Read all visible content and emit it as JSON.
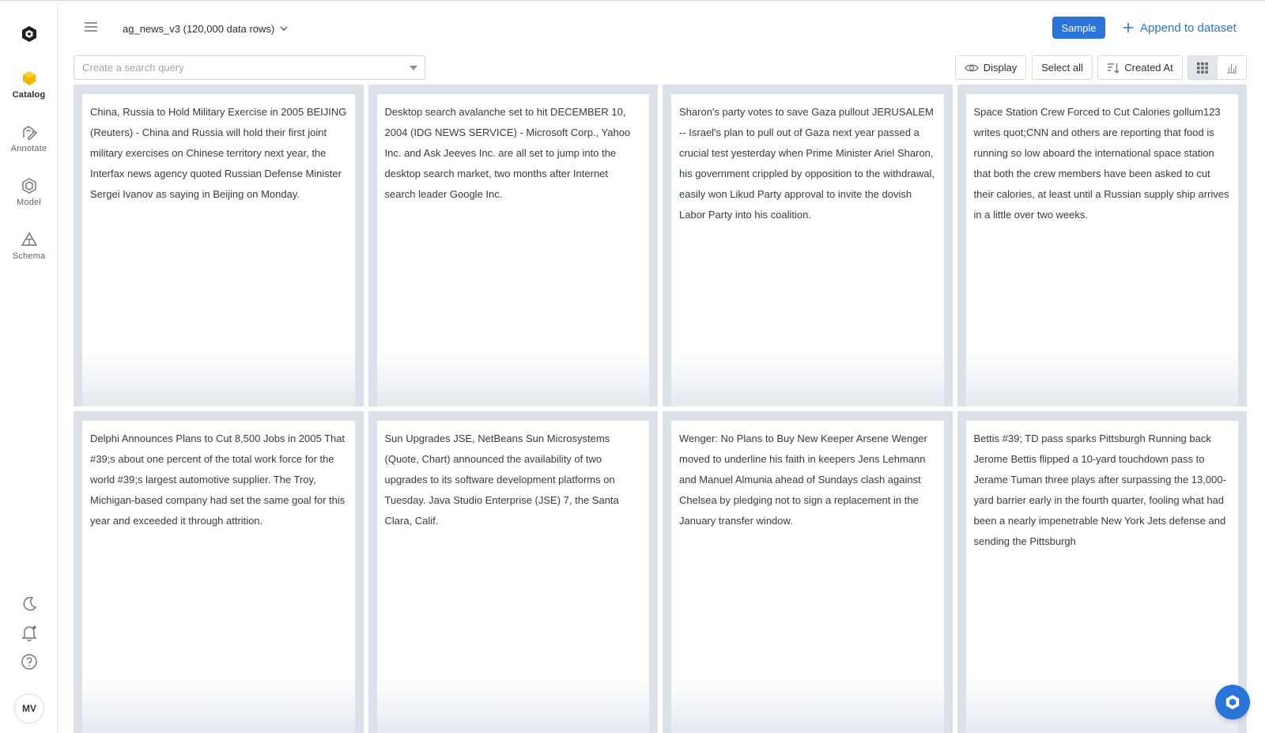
{
  "app": {
    "accent_color": "#2a74d8",
    "logo_icon": "labelbox-logo-icon"
  },
  "sidebar": {
    "items": [
      {
        "label": "Catalog",
        "icon": "catalog-icon",
        "active": true
      },
      {
        "label": "Annotate",
        "icon": "annotate-icon",
        "active": false
      },
      {
        "label": "Model",
        "icon": "model-icon",
        "active": false
      },
      {
        "label": "Schema",
        "icon": "schema-icon",
        "active": false
      }
    ],
    "bottom_icons": [
      "dark-mode-moon-icon",
      "notifications-bell-icon",
      "help-icon"
    ],
    "avatar_initials": "MV"
  },
  "header": {
    "dataset_label": "ag_news_v3 (120,000 data rows)",
    "sample_label": "Sample",
    "append_label": "Append to dataset"
  },
  "toolbar": {
    "search_placeholder": "Create a search query",
    "display_label": "Display",
    "select_all_label": "Select all",
    "sort_label": "Created At",
    "active_view": "grid"
  },
  "cards": [
    {
      "text": "China, Russia to Hold Military Exercise in 2005 BEIJING (Reuters) - China and Russia will hold their first  joint military exercises on Chinese territory next year, the  Interfax news agency quoted Russian Defense Minister Sergei  Ivanov as saying in Beijing on Monday."
    },
    {
      "text": "Desktop search avalanche set to hit DECEMBER 10, 2004 (IDG NEWS SERVICE) - Microsoft Corp., Yahoo Inc. and Ask Jeeves Inc. are all set to jump into the desktop search market, two months after Internet search leader Google Inc."
    },
    {
      "text": "Sharon's party votes to save Gaza pullout  JERUSALEM -- Israel's plan to pull out of Gaza next year passed a crucial test yesterday when Prime Minister Ariel Sharon, his government crippled by opposition to the withdrawal, easily won Likud Party approval to invite the dovish Labor Party into his coalition."
    },
    {
      "text": "Space Station Crew Forced to Cut Calories gollum123 writes  quot;CNN and others are reporting that food is running so low aboard the international space station that both the crew members have been asked to cut their calories, at least until a Russian supply ship arrives in a little over two weeks."
    },
    {
      "text": "Delphi Announces Plans to Cut 8,500 Jobs in 2005 That #39;s about one percent of the total work force for the world #39;s largest automotive supplier. The Troy, Michigan-based company had set the same goal for this year and exceeded it through attrition."
    },
    {
      "text": "Sun Upgrades JSE, NetBeans Sun Microsystems (Quote, Chart) announced the availability of two upgrades to its software development platforms on Tuesday. Java Studio Enterprise (JSE) 7, the Santa Clara, Calif."
    },
    {
      "text": "Wenger: No Plans to Buy New Keeper Arsene Wenger moved to underline his faith in keepers Jens Lehmann and Manuel Almunia ahead of Sundays clash against Chelsea by pledging not to sign a replacement in the January transfer window."
    },
    {
      "text": "Bettis #39; TD pass sparks Pittsburgh Running back Jerome Bettis flipped a 10-yard touchdown pass to Jerame Tuman three plays after surpassing the 13,000-yard barrier early in the fourth quarter, fooling what had been a nearly impenetrable New York Jets defense and sending the Pittsburgh"
    }
  ]
}
